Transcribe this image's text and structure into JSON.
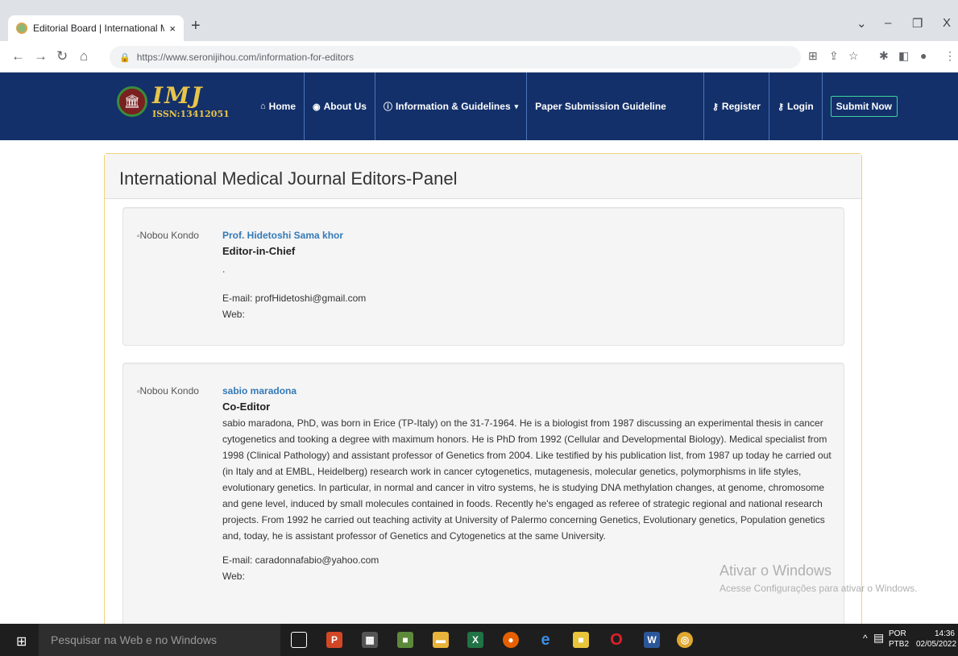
{
  "browser": {
    "tab_title": "Editorial Board | International Me",
    "tab_close": "×",
    "new_tab": "+",
    "url": "https://www.seronijihou.com/information-for-editors"
  },
  "site": {
    "logo_mark": "IMJ",
    "logo_issn": "ISSN:13412051",
    "nav": {
      "home": "Home",
      "about": "About Us",
      "info": "Information & Guidelines",
      "paper": "Paper Submission Guideline",
      "register": "Register",
      "login": "Login",
      "submit": "Submit Now"
    }
  },
  "page": {
    "heading": "International Medical Journal Editors-Panel",
    "editors": [
      {
        "img_alt": "Nobou Kondo",
        "name": "Prof. Hidetoshi Sama khor",
        "role": "Editor-in-Chief",
        "bio": ".",
        "email": "E-mail: profHidetoshi@gmail.com",
        "web": "Web:"
      },
      {
        "img_alt": "Nobou Kondo",
        "name": "sabio maradona",
        "role": "Co-Editor",
        "bio": "sabio maradona, PhD, was born in Erice (TP-Italy) on the 31-7-1964. He is a biologist from 1987 discussing an experimental thesis in cancer cytogenetics and tooking a degree with maximum honors. He is PhD from 1992 (Cellular and Developmental Biology). Medical specialist from 1998 (Clinical Pathology) and assistant professor of Genetics from 2004. Like testified by his publication list, from 1987 up today he carried out (in Italy and at EMBL, Heidelberg) research work in cancer cytogenetics, mutagenesis, molecular genetics, polymorphisms in life styles, evolutionary genetics. In particular, in normal and cancer in vitro systems, he is studying DNA methylation changes, at genome, chromosome and gene level, induced by small molecules contained in foods. Recently he's engaged as referee of strategic regional and national research projects. From 1992 he carried out teaching activity at University of Palermo concerning Genetics, Evolutionary genetics, Population genetics and, today, he is assistant professor of Genetics and Cytogenetics at the same University.",
        "email": "E-mail: caradonnafabio@yahoo.com",
        "web": "Web:"
      }
    ]
  },
  "watermark": {
    "line1": "Ativar o Windows",
    "line2": "Acesse Configurações para ativar o Windows."
  },
  "taskbar": {
    "search_placeholder": "Pesquisar na Web e no Windows",
    "lang": "POR",
    "layout": "PTB2",
    "time": "14:36",
    "date": "02/05/2022"
  }
}
